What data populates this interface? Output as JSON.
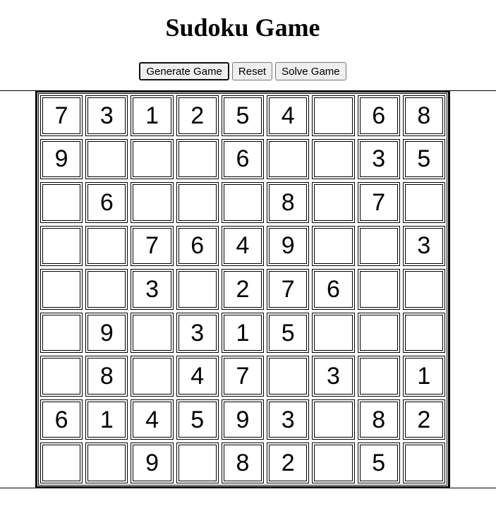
{
  "title": "Sudoku Game",
  "controls": {
    "generate_label": "Generate Game",
    "reset_label": "Reset",
    "solve_label": "Solve Game"
  },
  "grid": [
    [
      "7",
      "3",
      "1",
      "2",
      "5",
      "4",
      "",
      "6",
      "8"
    ],
    [
      "9",
      "",
      "",
      "",
      "6",
      "",
      "",
      "3",
      "5"
    ],
    [
      "",
      "6",
      "",
      "",
      "",
      "8",
      "",
      "7",
      ""
    ],
    [
      "",
      "",
      "7",
      "6",
      "4",
      "9",
      "",
      "",
      "3"
    ],
    [
      "",
      "",
      "3",
      "",
      "2",
      "7",
      "6",
      "",
      ""
    ],
    [
      "",
      "9",
      "",
      "3",
      "1",
      "5",
      "",
      "",
      ""
    ],
    [
      "",
      "8",
      "",
      "4",
      "7",
      "",
      "3",
      "",
      "1"
    ],
    [
      "6",
      "1",
      "4",
      "5",
      "9",
      "3",
      "",
      "8",
      "2"
    ],
    [
      "",
      "",
      "9",
      "",
      "8",
      "2",
      "",
      "5",
      ""
    ]
  ]
}
